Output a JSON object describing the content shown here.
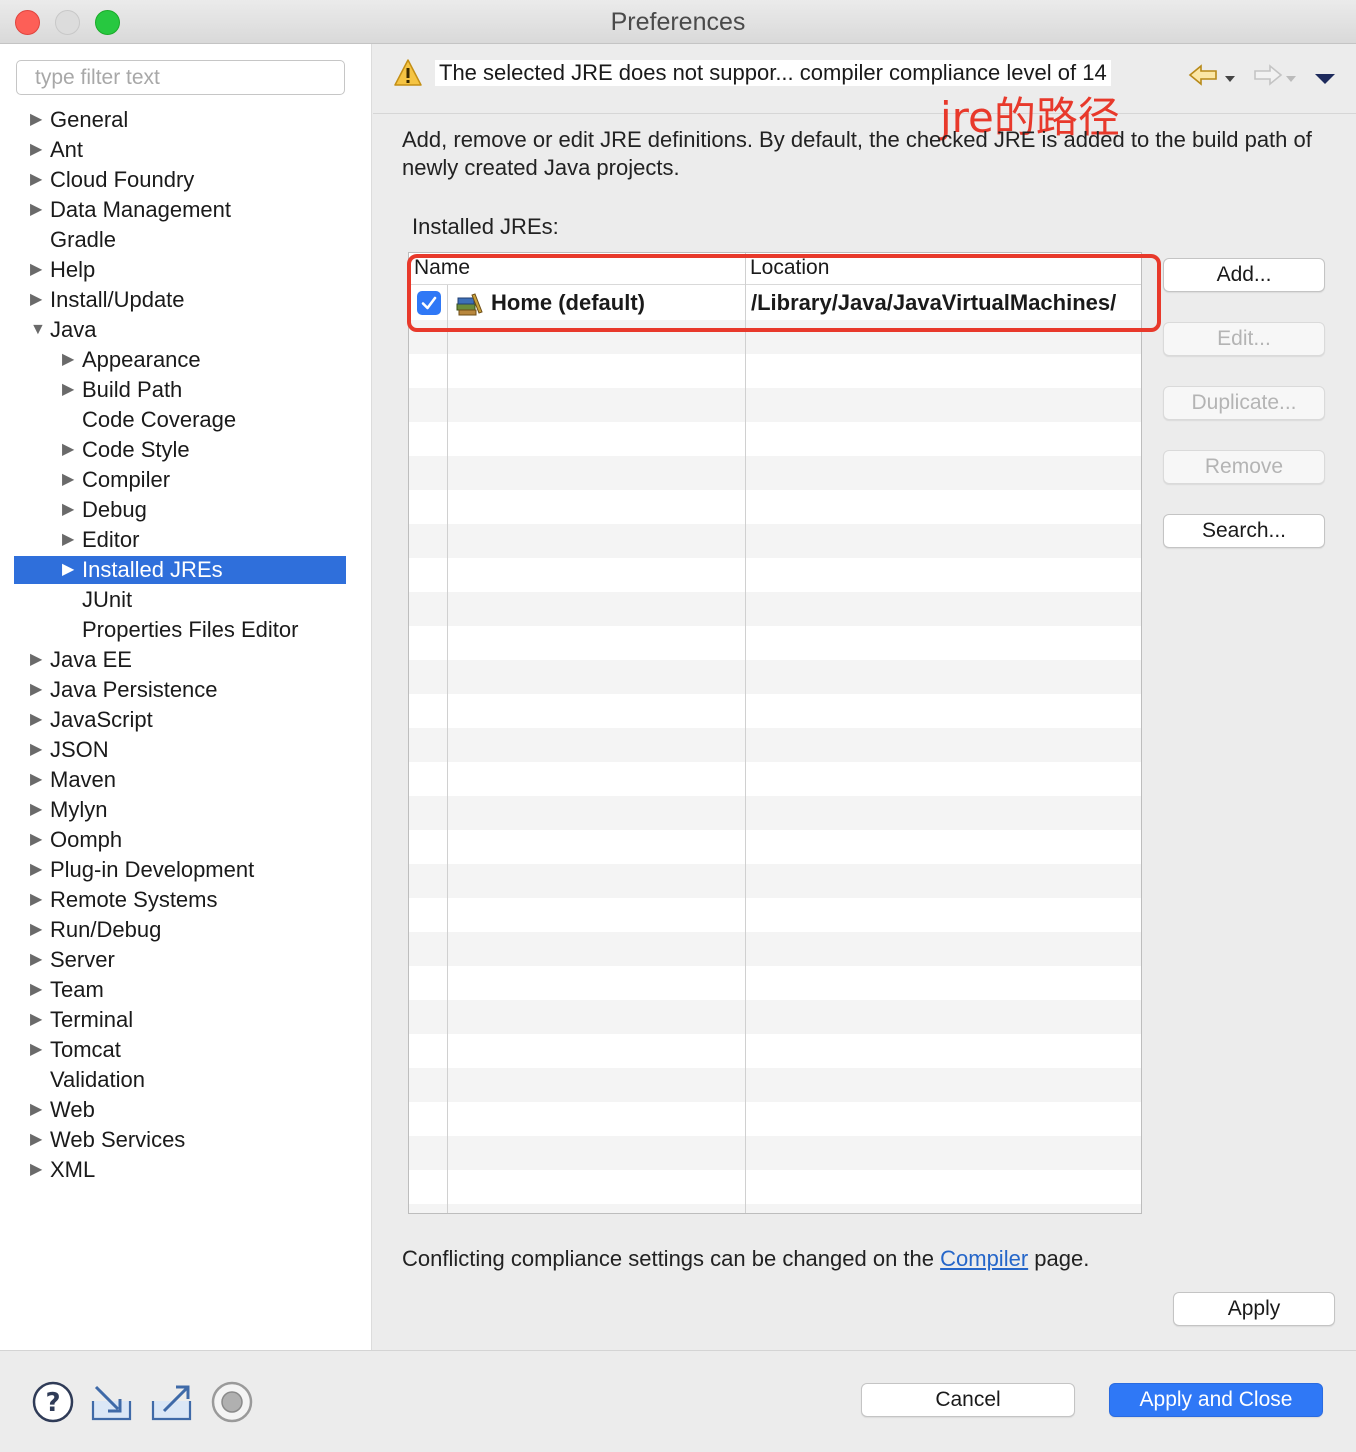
{
  "window": {
    "title": "Preferences"
  },
  "filter": {
    "placeholder": "type filter text"
  },
  "tree": {
    "items": [
      {
        "label": "General",
        "arrow": true,
        "level": 0
      },
      {
        "label": "Ant",
        "arrow": true,
        "level": 0
      },
      {
        "label": "Cloud Foundry",
        "arrow": true,
        "level": 0
      },
      {
        "label": "Data Management",
        "arrow": true,
        "level": 0
      },
      {
        "label": "Gradle",
        "arrow": false,
        "level": 0
      },
      {
        "label": "Help",
        "arrow": true,
        "level": 0
      },
      {
        "label": "Install/Update",
        "arrow": true,
        "level": 0
      },
      {
        "label": "Java",
        "arrow": true,
        "expanded": true,
        "level": 0
      },
      {
        "label": "Appearance",
        "arrow": true,
        "level": 1
      },
      {
        "label": "Build Path",
        "arrow": true,
        "level": 1
      },
      {
        "label": "Code Coverage",
        "arrow": false,
        "level": 1
      },
      {
        "label": "Code Style",
        "arrow": true,
        "level": 1
      },
      {
        "label": "Compiler",
        "arrow": true,
        "level": 1
      },
      {
        "label": "Debug",
        "arrow": true,
        "level": 1
      },
      {
        "label": "Editor",
        "arrow": true,
        "level": 1
      },
      {
        "label": "Installed JREs",
        "arrow": true,
        "level": 1,
        "selected": true
      },
      {
        "label": "JUnit",
        "arrow": false,
        "level": 1
      },
      {
        "label": "Properties Files Editor",
        "arrow": false,
        "level": 1
      },
      {
        "label": "Java EE",
        "arrow": true,
        "level": 0
      },
      {
        "label": "Java Persistence",
        "arrow": true,
        "level": 0
      },
      {
        "label": "JavaScript",
        "arrow": true,
        "level": 0
      },
      {
        "label": "JSON",
        "arrow": true,
        "level": 0
      },
      {
        "label": "Maven",
        "arrow": true,
        "level": 0
      },
      {
        "label": "Mylyn",
        "arrow": true,
        "level": 0
      },
      {
        "label": "Oomph",
        "arrow": true,
        "level": 0
      },
      {
        "label": "Plug-in Development",
        "arrow": true,
        "level": 0
      },
      {
        "label": "Remote Systems",
        "arrow": true,
        "level": 0
      },
      {
        "label": "Run/Debug",
        "arrow": true,
        "level": 0
      },
      {
        "label": "Server",
        "arrow": true,
        "level": 0
      },
      {
        "label": "Team",
        "arrow": true,
        "level": 0
      },
      {
        "label": "Terminal",
        "arrow": true,
        "level": 0
      },
      {
        "label": "Tomcat",
        "arrow": true,
        "level": 0
      },
      {
        "label": "Validation",
        "arrow": false,
        "level": 0
      },
      {
        "label": "Web",
        "arrow": true,
        "level": 0
      },
      {
        "label": "Web Services",
        "arrow": true,
        "level": 0
      },
      {
        "label": "XML",
        "arrow": true,
        "level": 0
      }
    ]
  },
  "header": {
    "warning_icon": "warning-icon",
    "warning_text": "The selected JRE does not suppor... compiler compliance level of 14",
    "nav": {
      "back_icon": "back-arrow-icon",
      "forward_icon": "forward-arrow-icon",
      "menu_icon": "view-menu-icon"
    }
  },
  "annotation": {
    "text": "jre的路径",
    "color": "#e8392b"
  },
  "page": {
    "description": "Add, remove or edit JRE definitions. By default, the checked JRE is added to the build path of newly created Java projects.",
    "installed_label": "Installed JREs:",
    "columns": {
      "name": "Name",
      "location": "Location"
    },
    "jres": [
      {
        "checked": true,
        "name": "Home (default)",
        "location": "/Library/Java/JavaVirtualMachines/"
      }
    ],
    "buttons": {
      "add": "Add...",
      "edit": "Edit...",
      "duplicate": "Duplicate...",
      "remove": "Remove",
      "search": "Search..."
    },
    "footer": {
      "before": "Conflicting compliance settings can be changed on the ",
      "link": "Compiler",
      "after": " page."
    },
    "apply": "Apply"
  },
  "bottom": {
    "icons": [
      "help-icon",
      "import-icon",
      "export-icon",
      "record-icon"
    ],
    "cancel": "Cancel",
    "apply_close": "Apply and Close"
  },
  "colors": {
    "accent": "#2f78f6",
    "selection": "#2f6fdb",
    "link": "#2566c9",
    "annotation": "#e8392b"
  }
}
